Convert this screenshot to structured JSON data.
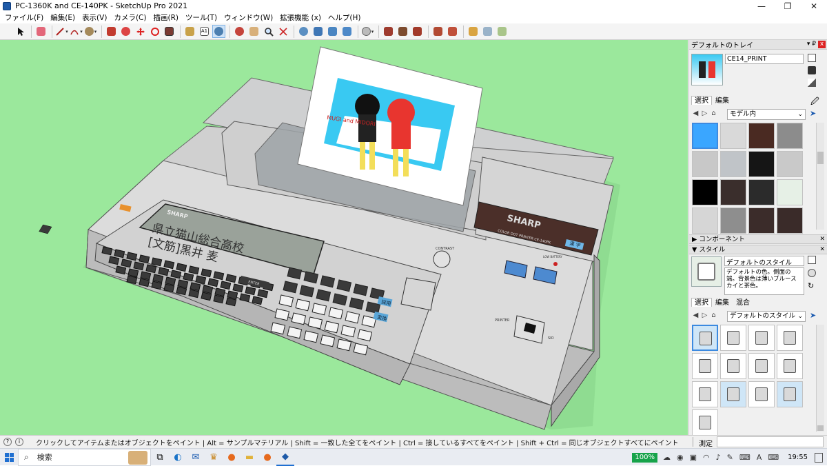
{
  "window": {
    "title": "PC-1360K and CE-140PK - SketchUp Pro 2021",
    "minimize": "—",
    "restore": "❐",
    "close": "✕"
  },
  "menu": [
    {
      "label": "ファイル(F)"
    },
    {
      "label": "編集(E)"
    },
    {
      "label": "表示(V)"
    },
    {
      "label": "カメラ(C)"
    },
    {
      "label": "描画(R)"
    },
    {
      "label": "ツール(T)"
    },
    {
      "label": "ウィンドウ(W)"
    },
    {
      "label": "拡張機能 (x)"
    },
    {
      "label": "ヘルプ(H)"
    }
  ],
  "toolbar_icons": [
    "select-icon",
    "eraser-icon",
    "line-icon",
    "arc-icon",
    "circle-icon",
    "pushpull-icon",
    "followme-icon",
    "move-icon",
    "rotate-icon",
    "scale-icon",
    "tape-measure-icon",
    "text-icon",
    "paint-bucket-icon",
    "orbit-icon",
    "pan-icon",
    "zoom-icon",
    "zoom-extents-icon",
    "section-plane-icon",
    "section-display-icon",
    "section-fill-icon",
    "section-cuts-icon",
    "geo-location-icon",
    "add-location-icon",
    "terrain-icon",
    "photo-texture-icon",
    "warehouse-icon",
    "extension-warehouse-icon",
    "component-icon",
    "model-info-icon",
    "layout-icon"
  ],
  "model": {
    "printer_brand": "SHARP",
    "printer_model": "COLOR DOT PRINTER CE-140PK",
    "printer_badge": "漢 字",
    "calc_brand": "SHARP",
    "lcd_line1": "県立猫山総合高校",
    "lcd_line2": "[文筋]黒井 麦",
    "paper_text": "MUGI and MIDORI",
    "contrast_label": "CONTRAST",
    "printer_label": "PRINTER",
    "sio_label": "SIO",
    "low_battery": "LOW BATTERY",
    "enter_key": "ENTER",
    "key_henkan": "変換",
    "key_kaijo": "採用"
  },
  "tray": {
    "header": "デフォルトのトレイ",
    "pin": "▾ ₽",
    "close": "x",
    "material_name": "CE14_PRINT",
    "materials_tabs": [
      "選択",
      "編集"
    ],
    "materials_dropdown": "モデル内",
    "components_title": "コンポーネント",
    "styles_title": "スタイル",
    "style_name": "デフォルトのスタイル",
    "style_desc": "デフォルトの色。側面の端。背景色は薄いブルースカイと茶色。",
    "styles_tabs": [
      "選択",
      "編集",
      "混合"
    ],
    "styles_dropdown": "デフォルトのスタイル",
    "swatch_colors": [
      "#3aa6ff",
      "#d9d9d9",
      "#4a2a22",
      "#8c8c8c",
      "#c8c8c8",
      "#c0c4c8",
      "#151515",
      "#c9c9c9",
      "#000000",
      "#3a2e2c",
      "#2b2b2b",
      "#e6f0e6",
      "#d6d6d6",
      "#8e8e8e",
      "#3b2c2a",
      "#3a2b29"
    ]
  },
  "status": {
    "message": "クリックしてアイテムまたはオブジェクトをペイント | Alt = サンプルマテリアル | Shift = 一致した全てをペイント | Ctrl = 接しているすべてをペイント | Shift + Ctrl = 同じオブジェクトすべてにペイント",
    "measurements_label": "測定",
    "info": "i"
  },
  "taskbar": {
    "search_placeholder": "検索",
    "zoom": "100%",
    "clock": "19:55",
    "font_icon": "A"
  },
  "colors": {
    "viewport_bg": "#9be89c",
    "accent": "#1f6fd1"
  }
}
